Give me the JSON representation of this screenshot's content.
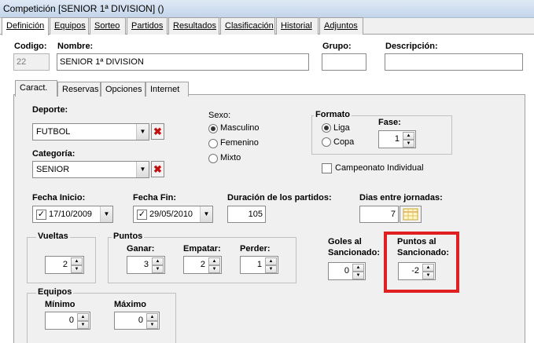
{
  "window": {
    "title": "Competición [SENIOR 1ª DIVISION] ()"
  },
  "main_tabs": [
    {
      "label": "Definición"
    },
    {
      "label": "Equipos"
    },
    {
      "label": "Sorteo"
    },
    {
      "label": "Partidos"
    },
    {
      "label": "Resultados"
    },
    {
      "label": "Clasificación"
    },
    {
      "label": "Historial"
    },
    {
      "label": "Adjuntos"
    }
  ],
  "header": {
    "codigo_label": "Codigo:",
    "codigo_value": "22",
    "nombre_label": "Nombre:",
    "nombre_value": "SENIOR  1ª DIVISION",
    "grupo_label": "Grupo:",
    "grupo_value": "",
    "descripcion_label": "Descripción:",
    "descripcion_value": ""
  },
  "inner_tabs": [
    {
      "label": "Caract."
    },
    {
      "label": "Reservas"
    },
    {
      "label": "Opciones"
    },
    {
      "label": "Internet"
    }
  ],
  "caract": {
    "deporte_label": "Deporte:",
    "deporte_value": "FUTBOL",
    "categoria_label": "Categoría:",
    "categoria_value": "SENIOR",
    "sexo_label": "Sexo:",
    "sexo_options": [
      {
        "label": "Masculino",
        "selected": true
      },
      {
        "label": "Femenino",
        "selected": false
      },
      {
        "label": "Mixto",
        "selected": false
      }
    ],
    "formato_label": "Formato",
    "formato_options": [
      {
        "label": "Liga",
        "selected": true
      },
      {
        "label": "Copa",
        "selected": false
      }
    ],
    "fase_label": "Fase:",
    "fase_value": "1",
    "campeonato_label": "Campeonato Individual",
    "fecha_inicio_label": "Fecha Inicio:",
    "fecha_inicio_value": "17/10/2009",
    "fecha_fin_label": "Fecha Fin:",
    "fecha_fin_value": "29/05/2010",
    "duracion_label": "Duración de los partidos:",
    "duracion_value": "105",
    "dias_label": "Dias entre jornadas:",
    "dias_value": "7",
    "vueltas_label": "Vueltas",
    "vueltas_value": "2",
    "puntos_label": "Puntos",
    "ganar_label": "Ganar:",
    "ganar_value": "3",
    "empatar_label": "Empatar:",
    "empatar_value": "2",
    "perder_label": "Perder:",
    "perder_value": "1",
    "goles_label_1": "Goles al",
    "goles_label_2": "Sancionado:",
    "goles_value": "0",
    "puntos_sanc_label_1": "Puntos al",
    "puntos_sanc_label_2": "Sancionado:",
    "puntos_sanc_value": "-2",
    "equipos_label": "Equipos",
    "minimo_label": "Mínimo",
    "minimo_value": "0",
    "maximo_label": "Máximo",
    "maximo_value": "0"
  },
  "colors": {
    "highlight": "#e02020",
    "delete_icon": "#c01010"
  }
}
